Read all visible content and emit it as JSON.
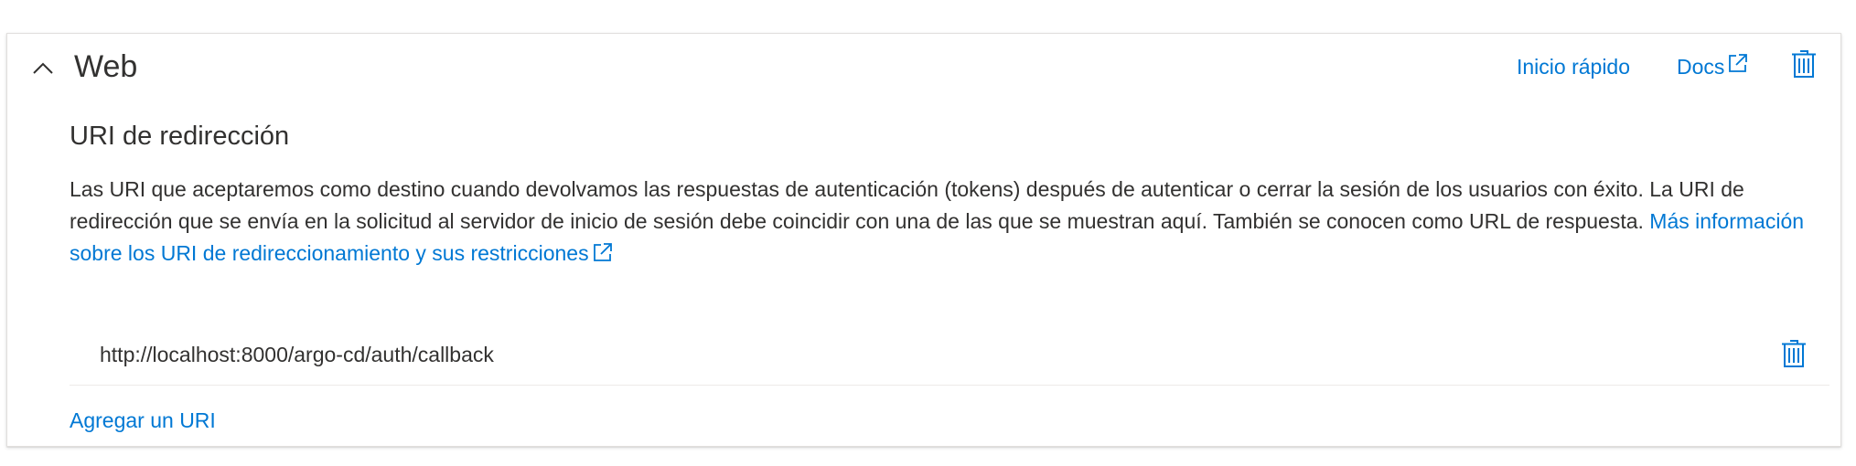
{
  "section": {
    "title": "Web",
    "collapse_icon": "chevron-up-icon"
  },
  "header_links": {
    "quickstart_label": "Inicio rápido",
    "docs_label": "Docs",
    "external_icon": "external-link-icon",
    "delete_icon": "trash-icon"
  },
  "redirect": {
    "heading": "URI de redirección",
    "description_text": "Las URI que aceptaremos como destino cuando devolvamos las respuestas de autenticación (tokens) después de autenticar o cerrar la sesión de los usuarios con éxito. La URI de redirección que se envía en la solicitud al servidor de inicio de sesión debe coincidir con una de las que se muestran aquí. También se conocen como URL de respuesta.",
    "learn_more_link": "Más información sobre los URI de redireccionamiento y sus restricciones",
    "uris": [
      "http://localhost:8000/argo-cd/auth/callback"
    ],
    "add_uri_label": "Agregar un URI"
  },
  "colors": {
    "accent": "#0078d4",
    "text": "#323130",
    "border": "#e1dfdd"
  }
}
